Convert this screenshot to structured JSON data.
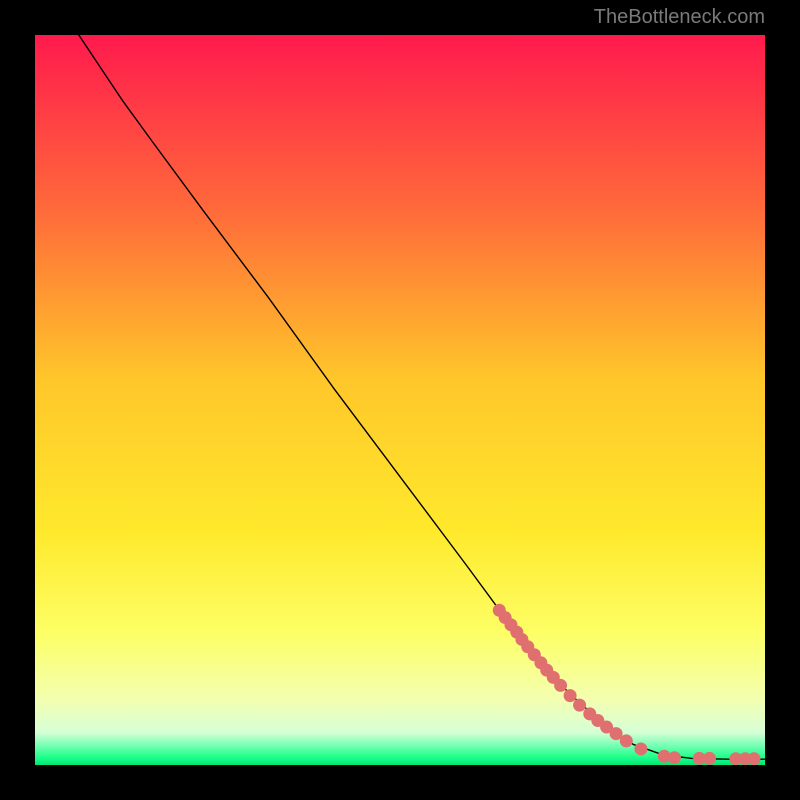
{
  "attribution": "TheBottleneck.com",
  "chart_data": {
    "type": "line",
    "title": "",
    "xlabel": "",
    "ylabel": "",
    "xlim": [
      0,
      100
    ],
    "ylim": [
      0,
      100
    ],
    "background_gradient": {
      "stops": [
        {
          "offset": 0.0,
          "color": "#ff1a4d"
        },
        {
          "offset": 0.24,
          "color": "#ff6a3a"
        },
        {
          "offset": 0.47,
          "color": "#ffc62a"
        },
        {
          "offset": 0.68,
          "color": "#ffe92c"
        },
        {
          "offset": 0.82,
          "color": "#fdff66"
        },
        {
          "offset": 0.91,
          "color": "#f3ffb0"
        },
        {
          "offset": 0.955,
          "color": "#d6ffd6"
        },
        {
          "offset": 0.975,
          "color": "#6cffb0"
        },
        {
          "offset": 0.99,
          "color": "#1aff88"
        },
        {
          "offset": 1.0,
          "color": "#00e673"
        }
      ]
    },
    "curve": [
      {
        "x": 6.0,
        "y": 100.0
      },
      {
        "x": 7.0,
        "y": 98.5
      },
      {
        "x": 9.0,
        "y": 95.5
      },
      {
        "x": 12.0,
        "y": 91.0
      },
      {
        "x": 16.0,
        "y": 85.5
      },
      {
        "x": 23.0,
        "y": 76.0
      },
      {
        "x": 32.0,
        "y": 64.0
      },
      {
        "x": 41.0,
        "y": 51.5
      },
      {
        "x": 50.0,
        "y": 39.5
      },
      {
        "x": 59.0,
        "y": 27.5
      },
      {
        "x": 66.0,
        "y": 18.0
      },
      {
        "x": 73.0,
        "y": 10.0
      },
      {
        "x": 78.0,
        "y": 5.5
      },
      {
        "x": 82.0,
        "y": 2.8
      },
      {
        "x": 86.0,
        "y": 1.4
      },
      {
        "x": 90.0,
        "y": 0.9
      },
      {
        "x": 95.0,
        "y": 0.8
      },
      {
        "x": 100.0,
        "y": 0.8
      }
    ],
    "dots": [
      {
        "x": 63.6,
        "y": 21.2
      },
      {
        "x": 64.4,
        "y": 20.2
      },
      {
        "x": 65.2,
        "y": 19.2
      },
      {
        "x": 66.0,
        "y": 18.2
      },
      {
        "x": 66.7,
        "y": 17.2
      },
      {
        "x": 67.5,
        "y": 16.2
      },
      {
        "x": 68.4,
        "y": 15.1
      },
      {
        "x": 69.3,
        "y": 14.0
      },
      {
        "x": 70.1,
        "y": 13.0
      },
      {
        "x": 71.0,
        "y": 12.0
      },
      {
        "x": 72.0,
        "y": 10.9
      },
      {
        "x": 73.3,
        "y": 9.5
      },
      {
        "x": 74.6,
        "y": 8.2
      },
      {
        "x": 76.0,
        "y": 7.0
      },
      {
        "x": 77.1,
        "y": 6.1
      },
      {
        "x": 78.3,
        "y": 5.2
      },
      {
        "x": 79.6,
        "y": 4.3
      },
      {
        "x": 81.0,
        "y": 3.3
      },
      {
        "x": 83.0,
        "y": 2.2
      },
      {
        "x": 86.2,
        "y": 1.2
      },
      {
        "x": 87.6,
        "y": 1.0
      },
      {
        "x": 91.0,
        "y": 0.9
      },
      {
        "x": 92.4,
        "y": 0.9
      },
      {
        "x": 96.0,
        "y": 0.85
      },
      {
        "x": 97.3,
        "y": 0.85
      },
      {
        "x": 98.5,
        "y": 0.85
      }
    ],
    "dot_color": "#e07070",
    "dot_radius_px": 6.5
  }
}
